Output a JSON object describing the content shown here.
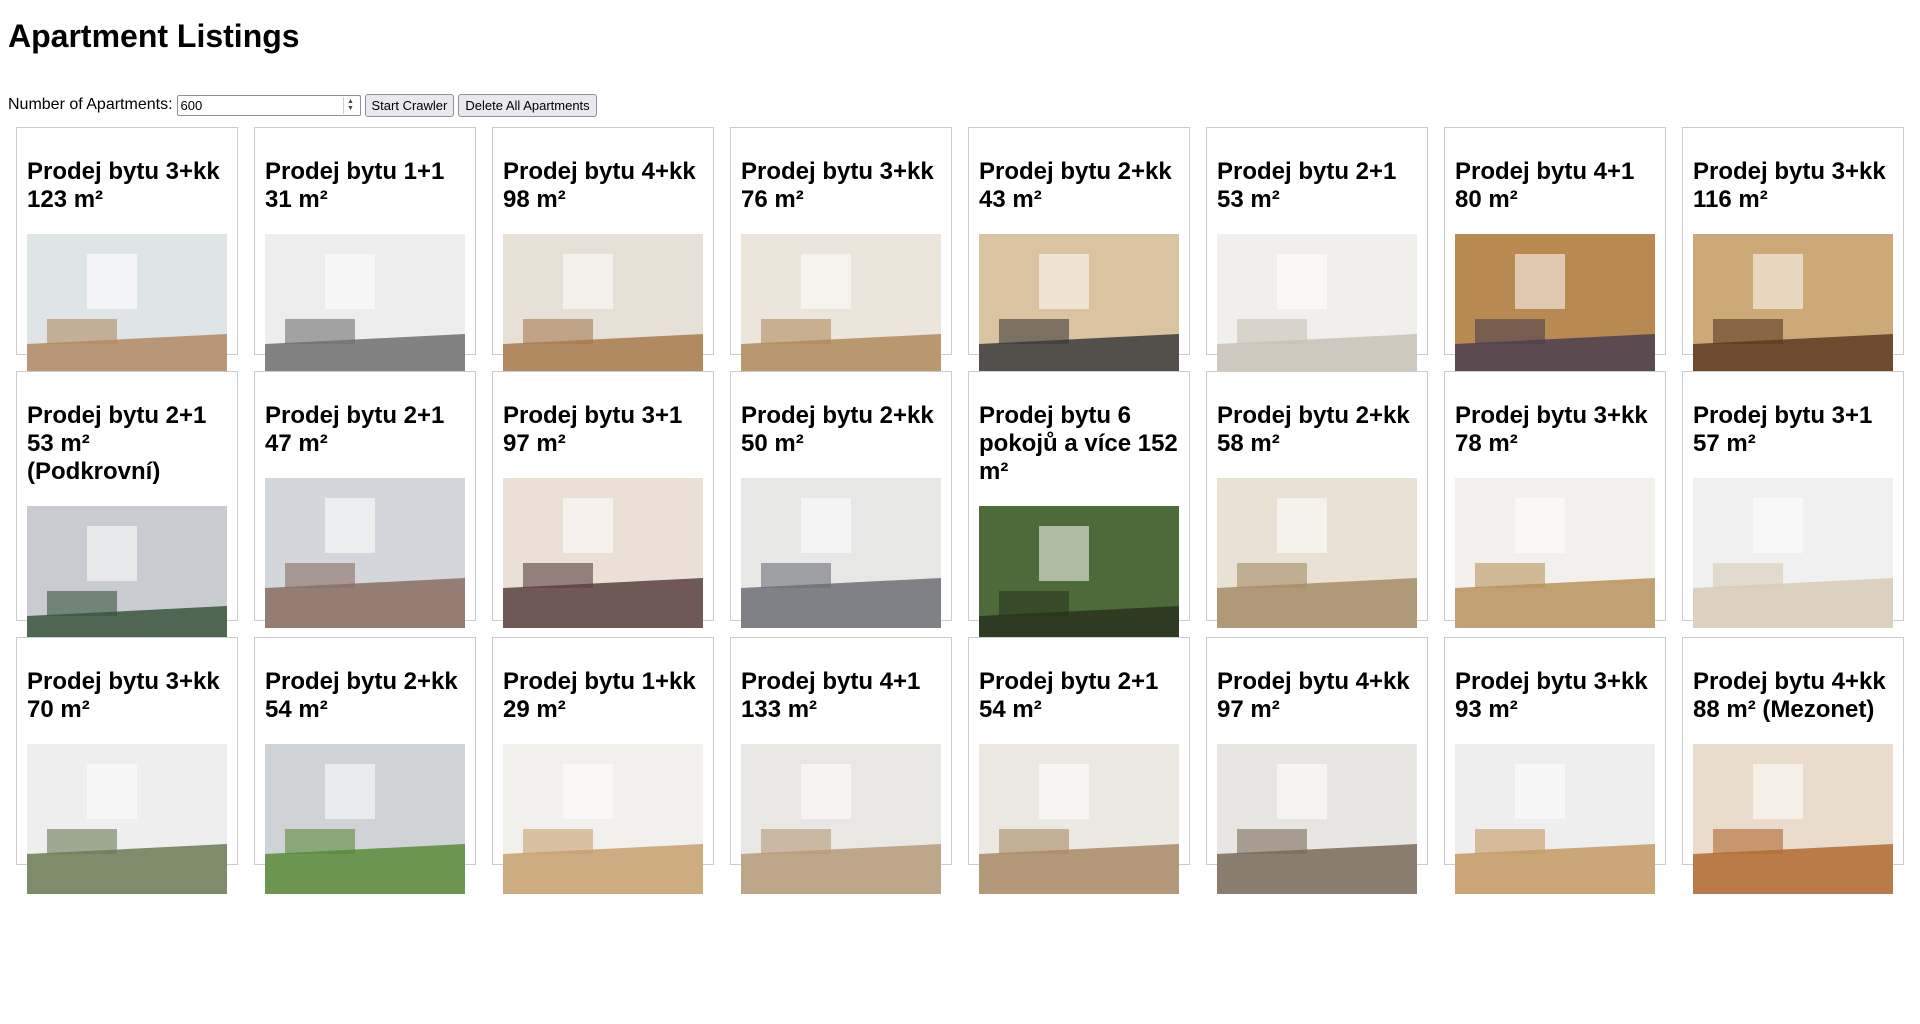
{
  "page": {
    "title": "Apartment Listings"
  },
  "controls": {
    "count_label": "Number of Apartments:",
    "count_value": "600",
    "start_label": "Start Crawler",
    "delete_label": "Delete All Apartments"
  },
  "listings": [
    {
      "title": "Prodej bytu 3+kk 123 m²",
      "photo": [
        "#dfe4e6",
        "#b08a63"
      ]
    },
    {
      "title": "Prodej bytu 1+1 31 m²",
      "photo": [
        "#ededed",
        "#6f6f6f"
      ]
    },
    {
      "title": "Prodej bytu 4+kk 98 m²",
      "photo": [
        "#e6e0d6",
        "#a77a4e"
      ]
    },
    {
      "title": "Prodej bytu 3+kk 76 m²",
      "photo": [
        "#ece5dc",
        "#b08a5c"
      ]
    },
    {
      "title": "Prodej bytu 2+kk 43 m²",
      "photo": [
        "#d9c3a0",
        "#3b3b3b"
      ]
    },
    {
      "title": "Prodej bytu 2+1 53 m²",
      "photo": [
        "#f1efeb",
        "#c9c1b6"
      ]
    },
    {
      "title": "Prodej bytu 4+1 80 m²",
      "photo": [
        "#b88a52",
        "#4a4050"
      ]
    },
    {
      "title": "Prodej bytu 3+kk 116 m²",
      "photo": [
        "#cda978",
        "#5a3b22"
      ]
    },
    {
      "title": "Prodej bytu 2+1 53 m² (Podkrovní)",
      "photo": [
        "#c8ccd0",
        "#39543c"
      ]
    },
    {
      "title": "Prodej bytu 2+1 47 m²",
      "photo": [
        "#d3d7db",
        "#8a6d62"
      ]
    },
    {
      "title": "Prodej bytu 3+1 97 m²",
      "photo": [
        "#eae0d5",
        "#5a4040"
      ]
    },
    {
      "title": "Prodej bytu 2+kk 50 m²",
      "photo": [
        "#e7e7e6",
        "#6d6f74"
      ]
    },
    {
      "title": "Prodej bytu 6 pokojů a více 152 m²",
      "photo": [
        "#4d6b3a",
        "#2a3320"
      ]
    },
    {
      "title": "Prodej bytu 2+kk 58 m²",
      "photo": [
        "#e9e1d3",
        "#a58c68"
      ]
    },
    {
      "title": "Prodej bytu 3+kk 78 m²",
      "photo": [
        "#f2f0ed",
        "#b8935a"
      ]
    },
    {
      "title": "Prodej bytu 3+1 57 m²",
      "photo": [
        "#f0f0f0",
        "#d8cbb5"
      ]
    },
    {
      "title": "Prodej bytu 3+kk 70 m²",
      "photo": [
        "#eeeeee",
        "#6b7a55"
      ]
    },
    {
      "title": "Prodej bytu 2+kk 54 m²",
      "photo": [
        "#cfd3d6",
        "#5a8a3a"
      ]
    },
    {
      "title": "Prodej bytu 1+kk 29 m²",
      "photo": [
        "#f2f0ec",
        "#c8a070"
      ]
    },
    {
      "title": "Prodej bytu 4+1 133 m²",
      "photo": [
        "#e9e7e3",
        "#b59a7a"
      ]
    },
    {
      "title": "Prodej bytu 2+1 54 m²",
      "photo": [
        "#ece8e2",
        "#a98a66"
      ]
    },
    {
      "title": "Prodej bytu 4+kk 97 m²",
      "photo": [
        "#e8e6e2",
        "#7a6a58"
      ]
    },
    {
      "title": "Prodej bytu 3+kk 93 m²",
      "photo": [
        "#eeeeee",
        "#c49a62"
      ]
    },
    {
      "title": "Prodej bytu 4+kk 88 m² (Mezonet)",
      "photo": [
        "#e9dccc",
        "#b06a30"
      ]
    }
  ]
}
